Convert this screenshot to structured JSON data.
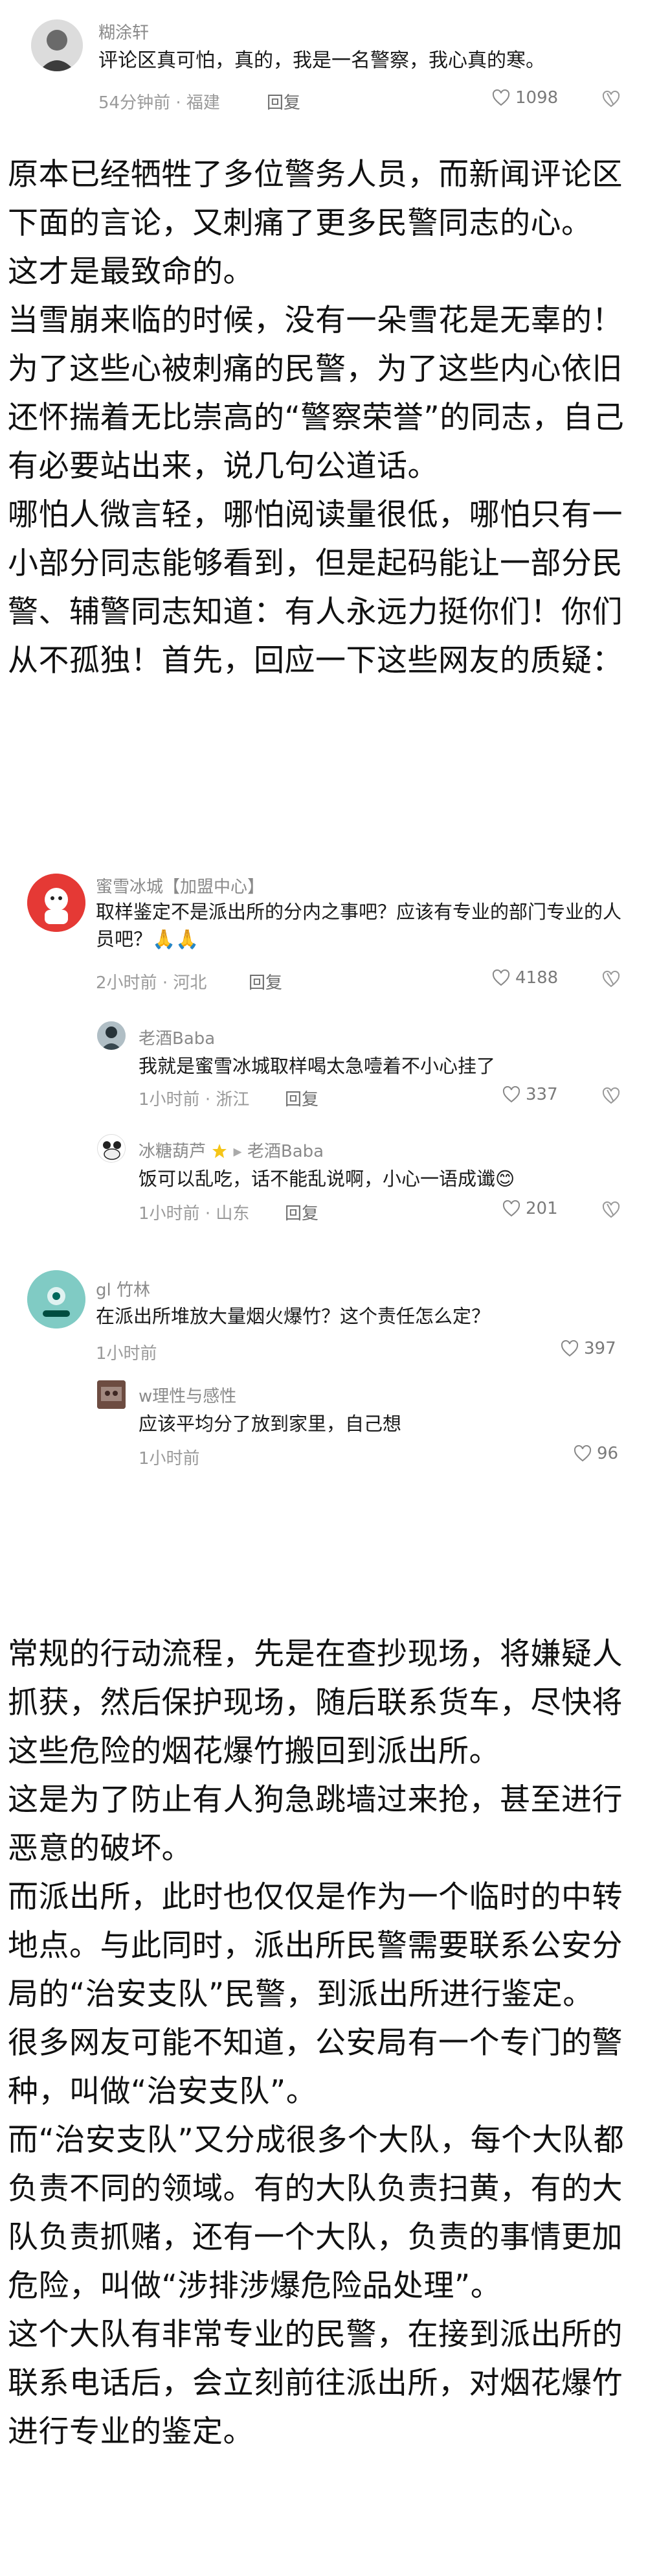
{
  "top_comment": {
    "username": "糊涂轩",
    "text": "评论区真可怕，真的，我是一名警察，我心真的寒。",
    "time": "54分钟前",
    "location": "福建",
    "reply_label": "回复",
    "likes": "1098"
  },
  "article_part1": [
    "原本已经牺牲了多位警务人员，而新闻评论区下面的言论，又刺痛了更多民警同志的心。",
    "这才是最致命的。",
    "当雪崩来临的时候，没有一朵雪花是无辜的！为了这些心被刺痛的民警，为了这些内心依旧还怀揣着无比崇高的“警察荣誉”的同志，自己有必要站出来，说几句公道话。",
    "哪怕人微言轻，哪怕阅读量很低，哪怕只有一小部分同志能够看到，但是起码能让一部分民警、辅警同志知道：有人永远力挺你们！你们从不孤独！首先，回应一下这些网友的质疑："
  ],
  "embedded_comments": {
    "c1": {
      "username": "蜜雪冰城【加盟中心】",
      "text": "取样鉴定不是派出所的分内之事吧？应该有专业的部门专业的人员吧？🙏🙏",
      "time": "2小时前",
      "location": "河北",
      "reply_label": "回复",
      "likes": "4188"
    },
    "c1_r1": {
      "username": "老酒Baba",
      "text": "我就是蜜雪冰城取样喝太急噎着不小心挂了",
      "time": "1小时前",
      "location": "浙江",
      "reply_label": "回复",
      "likes": "337"
    },
    "c1_r2": {
      "username": "冰糖葫芦",
      "arrow": "▸",
      "reply_to": "老酒Baba",
      "text": "饭可以乱吃，话不能乱说啊，小心一语成谶😊",
      "time": "1小时前",
      "location": "山东",
      "reply_label": "回复",
      "likes": "201"
    },
    "c2": {
      "username": "gl 竹林",
      "text": "在派出所堆放大量烟火爆竹？这个责任怎么定？",
      "time": "1小时前",
      "likes": "397"
    },
    "c2_r1": {
      "username": "w理性与感性",
      "text": "应该平均分了放到家里，自己想",
      "time": "1小时前",
      "likes": "96"
    }
  },
  "article_part2": [
    "常规的行动流程，先是在查抄现场，将嫌疑人抓获，然后保护现场，随后联系货车，尽快将这些危险的烟花爆竹搬回到派出所。",
    "这是为了防止有人狗急跳墙过来抢，甚至进行恶意的破坏。",
    "而派出所，此时也仅仅是作为一个临时的中转地点。与此同时，派出所民警需要联系公安分局的“治安支队”民警，到派出所进行鉴定。",
    "很多网友可能不知道，公安局有一个专门的警种，叫做“治安支队”。",
    "而“治安支队”又分成很多个大队，每个大队都负责不同的领域。有的大队负责扫黄，有的大队负责抓赌，还有一个大队，负责的事情更加危险，叫做“涉排涉爆危险品处理”。",
    "这个大队有非常专业的民警，在接到派出所的联系电话后，会立刻前往派出所，对烟花爆竹进行专业的鉴定。"
  ],
  "meta_separator": "·"
}
